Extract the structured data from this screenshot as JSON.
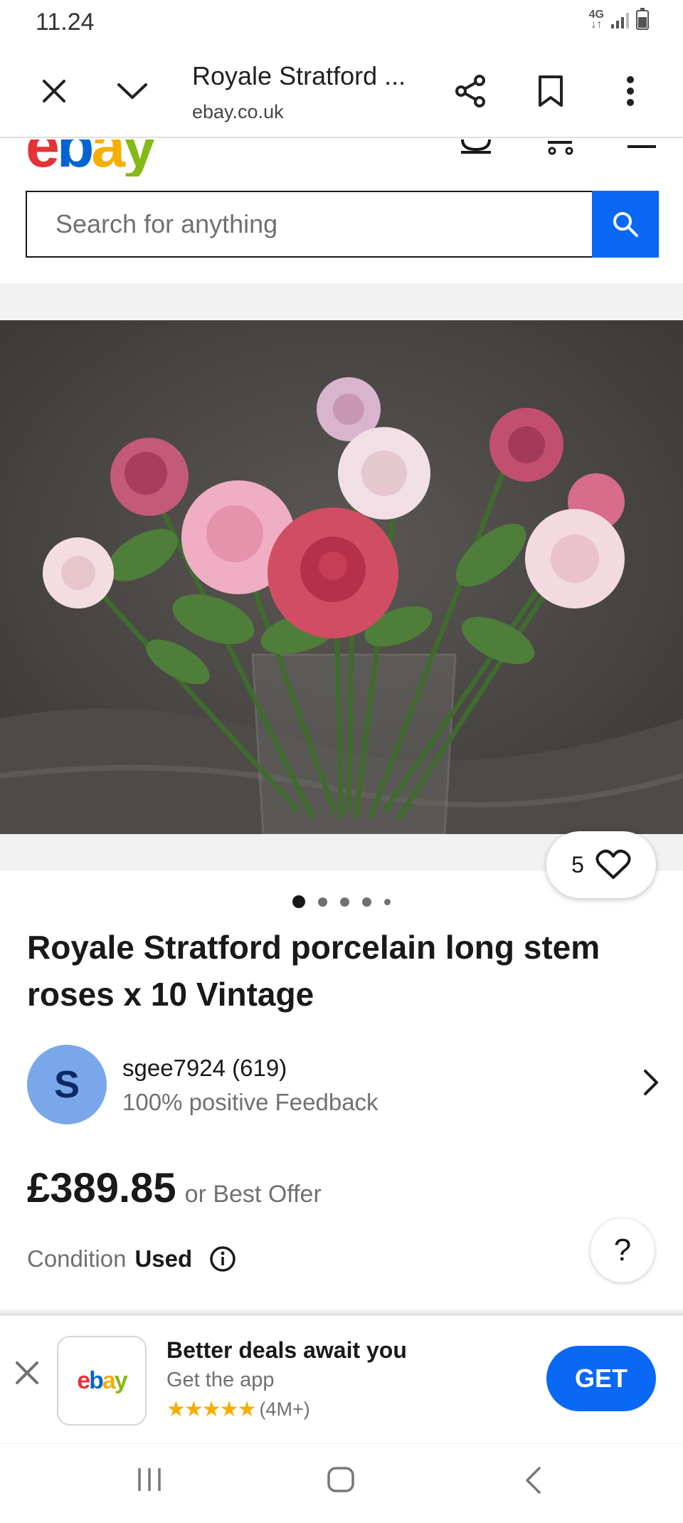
{
  "status_bar": {
    "time": "11.24",
    "network": "4G"
  },
  "toolbar": {
    "title": "Royale Stratford ...",
    "url": "ebay.co.uk"
  },
  "search": {
    "placeholder": "Search for anything"
  },
  "listing": {
    "watch_count": "5",
    "image_count": 5,
    "active_image": 1,
    "title": "Royale Stratford porcelain long stem roses x 10 Vintage",
    "seller": {
      "initial": "S",
      "name": "sgee7924 (619)",
      "feedback": "100% positive Feedback"
    },
    "price": "£389.85",
    "price_suffix": "or Best Offer",
    "condition_label": "Condition",
    "condition_value": "Used"
  },
  "app_banner": {
    "logo_text": "ebay",
    "title": "Better deals await you",
    "subtitle": "Get the app",
    "stars": "★★★★★",
    "rating_count": "(4M+)",
    "get_label": "GET"
  },
  "colors": {
    "accent": "#0968f6",
    "star": "#f5af02",
    "avatar": "#7aa7ea"
  },
  "help_label": "?"
}
